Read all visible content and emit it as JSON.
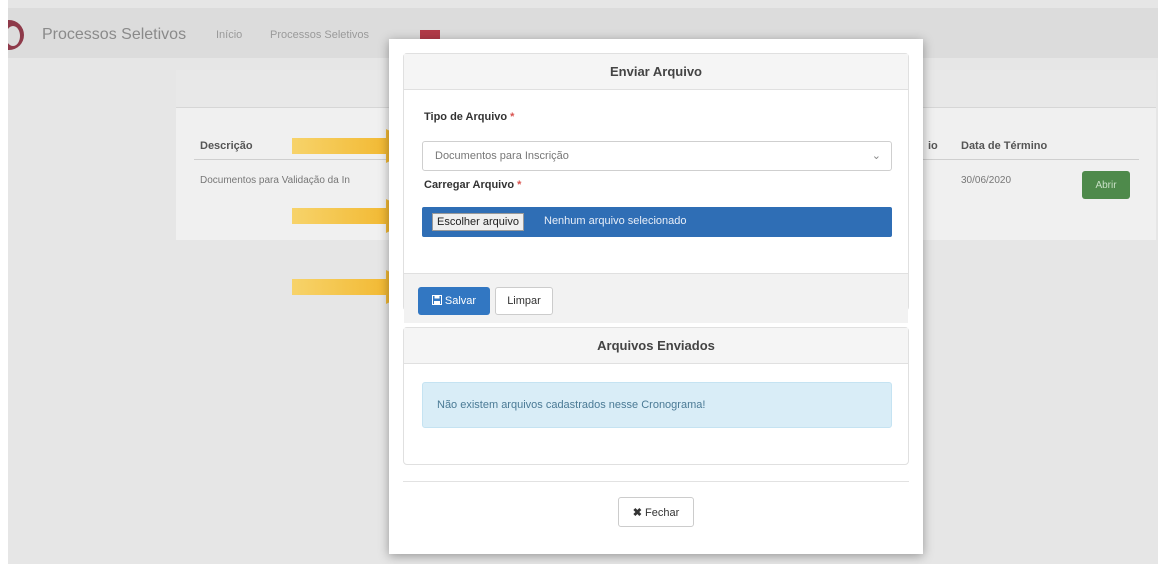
{
  "background": {
    "brand": "Processos Seletivos",
    "nav": [
      "Início",
      "Processos Seletivos"
    ],
    "table": {
      "headers": [
        "Descrição",
        "io",
        "Data de Término"
      ],
      "row": {
        "description": "Documentos para Validação da In",
        "end_date": "30/06/2020",
        "action": "Abrir"
      }
    }
  },
  "modal": {
    "title": "Enviar Arquivo",
    "file_type": {
      "label": "Tipo de Arquivo",
      "required_mark": "*",
      "value": "Documentos para Inscrição"
    },
    "upload": {
      "label": "Carregar Arquivo",
      "required_mark": "*",
      "button": "Escolher arquivo",
      "status": "Nenhum arquivo selecionado"
    },
    "actions": {
      "save": "Salvar",
      "clear": "Limpar"
    },
    "sent_files": {
      "title": "Arquivos Enviados",
      "empty_message": "Não existem arquivos cadastrados nesse Cronograma!"
    },
    "close": "Fechar"
  },
  "icons": {
    "save": "floppy-disk-icon",
    "close": "x-icon",
    "caret": "chevron-down-icon"
  },
  "colors": {
    "primary": "#3277c2",
    "file_input": "#2f6eb5",
    "alert_bg": "#d9edf7",
    "arrow": "#f2b71c",
    "success": "#4e8a4b"
  }
}
